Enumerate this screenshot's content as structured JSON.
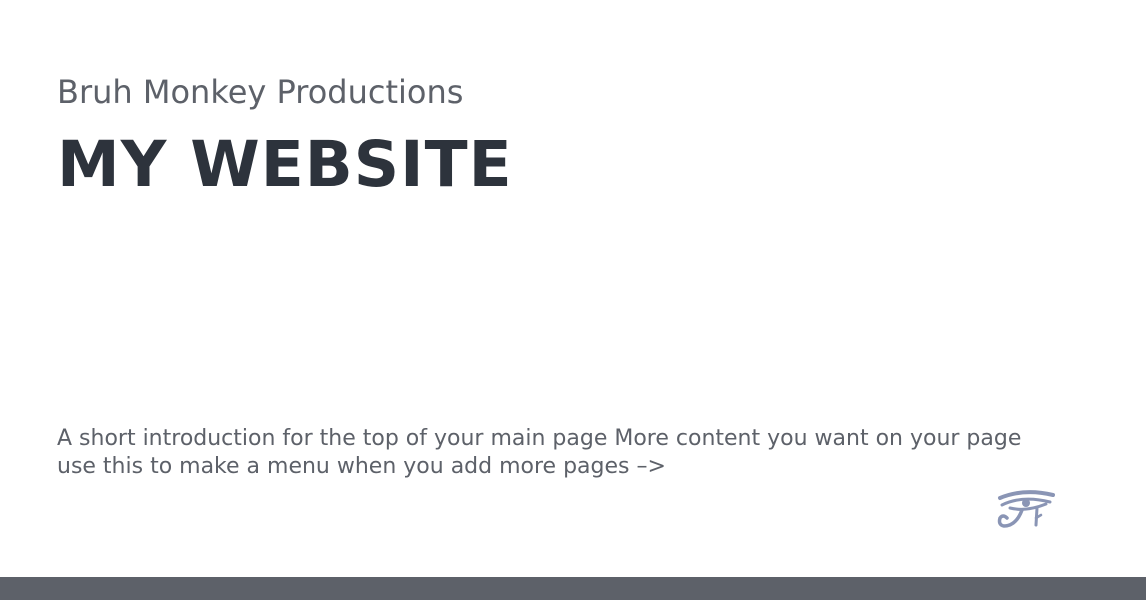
{
  "header": {
    "subtitle": "Bruh Monkey Productions",
    "title": "MY WEBSITE"
  },
  "main": {
    "intro": "A short introduction for the top of your main page More content you want on your page use this to make a menu when you add more pages –>"
  },
  "decor": {
    "icon": "eye-of-horus-icon",
    "icon_color": "#8a95b5"
  },
  "colors": {
    "text_primary": "#2d333c",
    "text_secondary": "#5d6169",
    "footer_bar": "#5d6169",
    "background": "#ffffff"
  }
}
